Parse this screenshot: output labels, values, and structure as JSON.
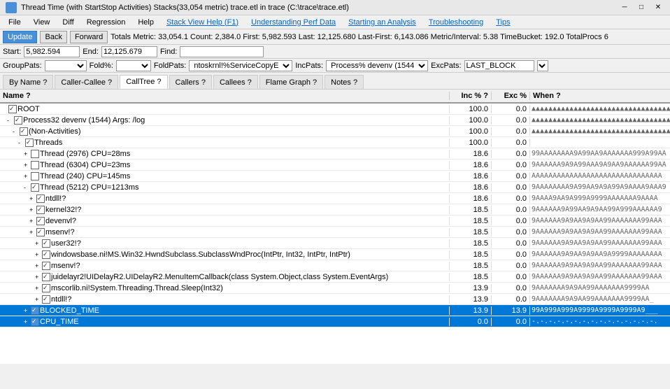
{
  "titleBar": {
    "title": "Thread Time (with StartStop Activities) Stacks(33,054 metric) trace.etl in trace (C:\\trace\\trace.etl)",
    "minimize": "─",
    "maximize": "□",
    "close": "✕"
  },
  "menuBar": {
    "items": [
      {
        "label": "File",
        "type": "normal"
      },
      {
        "label": "View",
        "type": "normal"
      },
      {
        "label": "Diff",
        "type": "normal"
      },
      {
        "label": "Regression",
        "type": "normal"
      },
      {
        "label": "Help",
        "type": "normal"
      },
      {
        "label": "Stack View Help (F1)",
        "type": "link"
      },
      {
        "label": "Understanding Perf Data",
        "type": "link"
      },
      {
        "label": "Starting an Analysis",
        "type": "link"
      },
      {
        "label": "Troubleshooting",
        "type": "link"
      },
      {
        "label": "Tips",
        "type": "link"
      }
    ]
  },
  "toolbar": {
    "updateBtn": "Update",
    "backBtn": "Back",
    "forwardBtn": "Forward",
    "totalsLabel": "Totals Metric: 33,054.1  Count: 2,384.0  First: 5,982.593  Last: 12,125.680  Last-First: 6,143.086  Metric/Interval: 5.38  TimeBucket: 192.0  TotalProcs 6"
  },
  "filterRow1": {
    "startLabel": "Start:",
    "startValue": "5,982.594",
    "endLabel": "End:",
    "endValue": "12,125.679",
    "findLabel": "Find:"
  },
  "filterRow2": {
    "groupPatsLabel": "GroupPats:",
    "foldLabel": "Fold%:",
    "foldPatsLabel": "FoldPats:",
    "foldPatsValue": "ntoskrnl!%ServiceCopyE",
    "incPatsLabel": "IncPats:",
    "incPatsValue": "Process% devenv (1544",
    "excPatsLabel": "ExcPats:",
    "excPatsValue": "LAST_BLOCK"
  },
  "tabs": [
    {
      "label": "By Name ?",
      "active": false
    },
    {
      "label": "Caller-Callee ?",
      "active": false
    },
    {
      "label": "CallTree ?",
      "active": true
    },
    {
      "label": "Callers ?",
      "active": false
    },
    {
      "label": "Callees ?",
      "active": false
    },
    {
      "label": "Flame Graph ?",
      "active": false
    },
    {
      "label": "Notes ?",
      "active": false
    }
  ],
  "columns": {
    "name": "Name ?",
    "inc": "Inc % ?",
    "exc": "Exc %",
    "when": "When ?"
  },
  "rows": [
    {
      "indent": 0,
      "expander": "",
      "checkbox": "checked",
      "label": "ROOT",
      "inc": "100.0",
      "exc": "0.0",
      "when": "▲▲▲▲▲▲▲▲▲▲▲▲▲▲▲▲▲▲▲▲▲▲▲▲▲▲▲▲▲▲▲▲▲▲",
      "highlight": false,
      "selected": false
    },
    {
      "indent": 1,
      "expander": "-",
      "checkbox": "checked",
      "label": "Process32 devenv (1544) Args:  /log",
      "inc": "100.0",
      "exc": "0.0",
      "when": "▲▲▲▲▲▲▲▲▲▲▲▲▲▲▲▲▲▲▲▲▲▲▲▲▲▲▲▲▲▲▲▲▲▲",
      "highlight": false,
      "selected": false
    },
    {
      "indent": 2,
      "expander": "-",
      "checkbox": "checked",
      "label": "(Non-Activities)",
      "inc": "100.0",
      "exc": "0.0",
      "when": "▲▲▲▲▲▲▲▲▲▲▲▲▲▲▲▲▲▲▲▲▲▲▲▲▲▲▲▲▲▲▲▲▲▲",
      "highlight": false,
      "selected": false
    },
    {
      "indent": 3,
      "expander": "-",
      "checkbox": "checked",
      "label": "Threads",
      "inc": "100.0",
      "exc": "0.0",
      "when": "",
      "highlight": false,
      "selected": false
    },
    {
      "indent": 4,
      "expander": "+",
      "checkbox": "empty",
      "label": "Thread (2976) CPU=28ms",
      "inc": "18.6",
      "exc": "0.0",
      "when": "99AAAAAAAA9A99AA9AAAAAAA999A99AA",
      "highlight": false,
      "selected": false
    },
    {
      "indent": 4,
      "expander": "+",
      "checkbox": "empty",
      "label": "Thread (6304) CPU=23ms",
      "inc": "18.6",
      "exc": "0.0",
      "when": "9AAAAAA9A9A99AAA9A9AA9AAAAAA99AA",
      "highlight": false,
      "selected": false
    },
    {
      "indent": 4,
      "expander": "+",
      "checkbox": "empty",
      "label": "Thread (240) CPU=145ms",
      "inc": "18.6",
      "exc": "0.0",
      "when": "AAAAAAAAAAAAAAAAAAAAAAAAAAAAAAA",
      "highlight": false,
      "selected": false
    },
    {
      "indent": 4,
      "expander": "-",
      "checkbox": "checked",
      "label": "Thread (5212) CPU=1213ms",
      "inc": "18.6",
      "exc": "0.0",
      "when": "9AAAAAAAA9A99AA9A9A99A9AAAA9AAA9",
      "highlight": false,
      "selected": false
    },
    {
      "indent": 5,
      "expander": "+",
      "checkbox": "checked",
      "label": "ntdll!?",
      "inc": "18.6",
      "exc": "0.0",
      "when": "9AAAA9AA9A999A9999AAAAAAA9AAAA",
      "highlight": false,
      "selected": false
    },
    {
      "indent": 5,
      "expander": "+",
      "checkbox": "checked",
      "label": "kernel32!?",
      "inc": "18.5",
      "exc": "0.0",
      "when": "9AAAAAA9A99AA9A9AA99A999AAAAAA9",
      "highlight": false,
      "selected": false
    },
    {
      "indent": 5,
      "expander": "+",
      "checkbox": "checked",
      "label": "devenvl?",
      "inc": "18.5",
      "exc": "0.0",
      "when": "9AAAAAA9A9AA9A9AA99AAAAAAA99AAA",
      "highlight": false,
      "selected": false
    },
    {
      "indent": 5,
      "expander": "+",
      "checkbox": "checked",
      "label": "msenv!?",
      "inc": "18.5",
      "exc": "0.0",
      "when": "9AAAAAA9A9AA9A9AA99AAAAAAA99AAA",
      "highlight": false,
      "selected": false
    },
    {
      "indent": 6,
      "expander": "+",
      "checkbox": "checked",
      "label": "user32!?",
      "inc": "18.5",
      "exc": "0.0",
      "when": "9AAAAAA9A9AA9A9AA99AAAAAAA99AAA",
      "highlight": false,
      "selected": false
    },
    {
      "indent": 6,
      "expander": "+",
      "checkbox": "checked",
      "label": "windowsbase.ni!MS.Win32.HwndSubclass.SubclassWndProc(IntPtr, Int32, IntPtr, IntPtr)",
      "inc": "18.5",
      "exc": "0.0",
      "when": "9AAAAAA9A9AA9A9AA9A9999AAAAAAAA",
      "highlight": false,
      "selected": false
    },
    {
      "indent": 6,
      "expander": "+",
      "checkbox": "checked",
      "label": "msenv!?",
      "inc": "18.5",
      "exc": "0.0",
      "when": "9AAAAAA9A9AA9A9AA99AAAAAAA99AAA",
      "highlight": false,
      "selected": false
    },
    {
      "indent": 6,
      "expander": "+",
      "checkbox": "checked",
      "label": "juidelayr2!UIDelayR2.UIDelayR2.MenuItemCallback(class System.Object,class System.EventArgs)",
      "inc": "18.5",
      "exc": "0.0",
      "when": "9AAAAAA9A9AA9A9AA99AAAAAAA99AAA",
      "highlight": false,
      "selected": false
    },
    {
      "indent": 6,
      "expander": "+",
      "checkbox": "checked",
      "label": "mscorlib.ni!System.Threading.Thread.Sleep(Int32)",
      "inc": "13.9",
      "exc": "0.0",
      "when": "9AAAAAAA9A9AA99AAAAAAA9999AA",
      "highlight": false,
      "selected": false
    },
    {
      "indent": 6,
      "expander": "+",
      "checkbox": "checked",
      "label": "ntdll!?",
      "inc": "13.9",
      "exc": "0.0",
      "when": "9AAAAAAA9A9AA99AAAAAAA9999AA_",
      "highlight": false,
      "selected": false
    },
    {
      "indent": 4,
      "expander": "+",
      "checkbox": "checked-blue",
      "label": "BLOCKED_TIME",
      "inc": "13.9",
      "exc": "13.9",
      "when": "99A999A999A9999A9999A9999A9___",
      "highlight": true,
      "selected": true
    },
    {
      "indent": 4,
      "expander": "+",
      "checkbox": "checked-blue",
      "label": "CPU_TIME",
      "inc": "0.0",
      "exc": "0.0",
      "when": "-.-.-.-.-.-.-.-.-.-.-.-.-.-.-.",
      "highlight": false,
      "selected": true
    }
  ]
}
